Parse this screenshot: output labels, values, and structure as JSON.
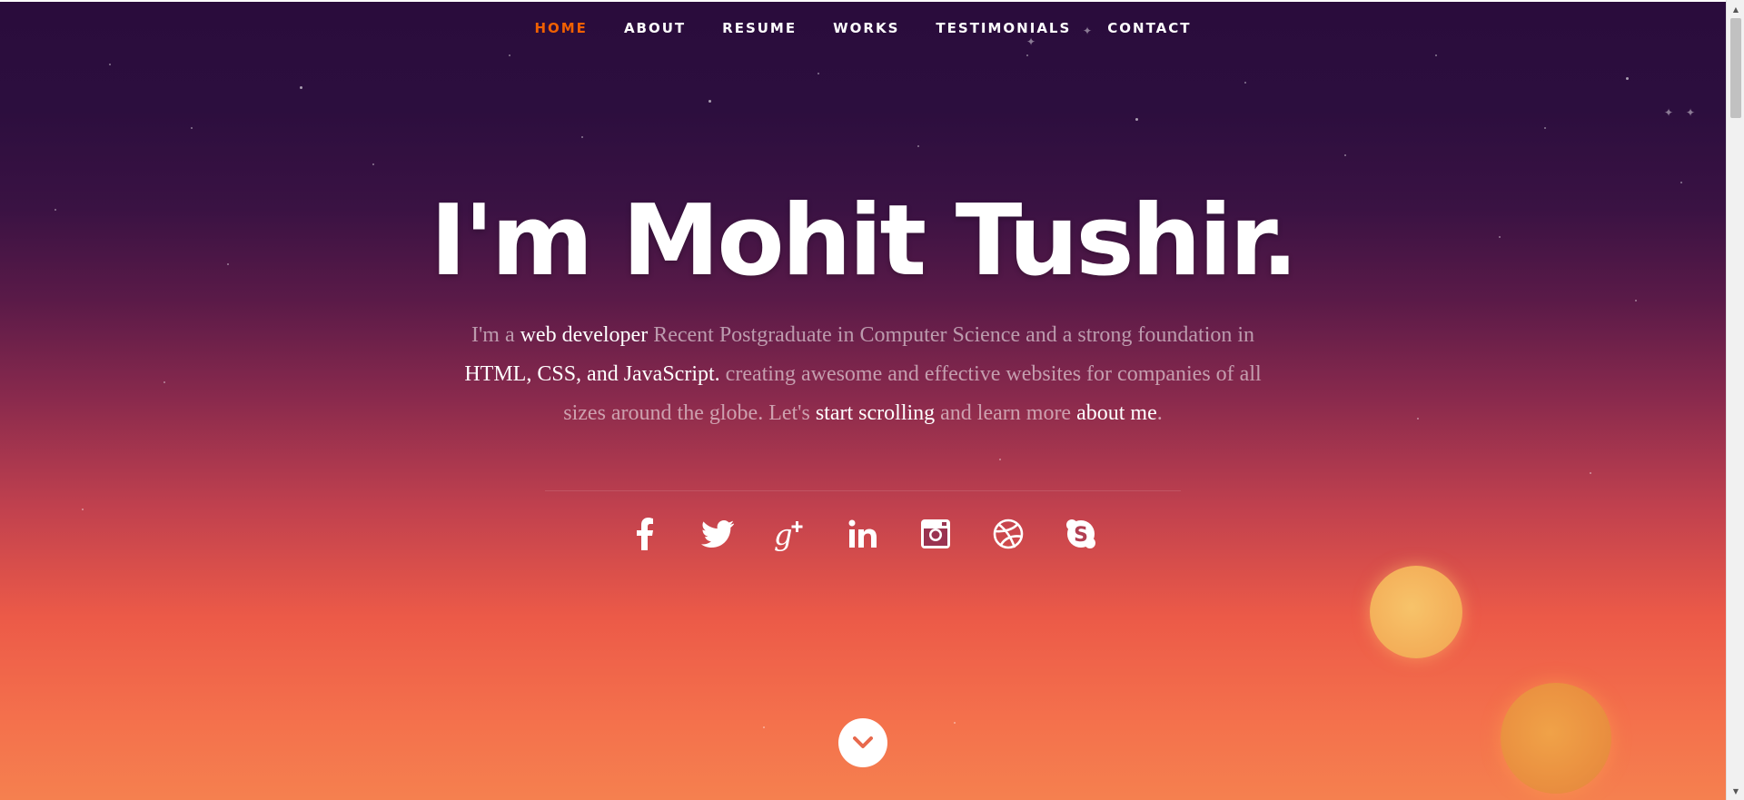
{
  "nav": {
    "items": [
      {
        "label": "HOME",
        "active": true
      },
      {
        "label": "ABOUT",
        "active": false
      },
      {
        "label": "RESUME",
        "active": false
      },
      {
        "label": "WORKS",
        "active": false
      },
      {
        "label": "TESTIMONIALS",
        "active": false
      },
      {
        "label": "CONTACT",
        "active": false
      }
    ]
  },
  "hero": {
    "title": "I'm Mohit Tushir.",
    "intro": {
      "p1": "I'm a ",
      "h1": "web developer",
      "p2": " Recent Postgraduate in Computer Science and a strong foundation in ",
      "h2": "HTML, CSS, and JavaScript.",
      "p3": " creating awesome and effective websites for companies of all sizes around the globe. Let's ",
      "h3": "start scrolling",
      "p4": " and learn more ",
      "h4": "about me",
      "p5": "."
    }
  },
  "social": {
    "icons": [
      "facebook-icon",
      "twitter-icon",
      "google-plus-icon",
      "linkedin-icon",
      "instagram-icon",
      "dribbble-icon",
      "skype-icon"
    ]
  },
  "colors": {
    "accent": "#f06000",
    "text": "#ffffff",
    "muted_text": "rgba(255,255,255,0.55)"
  }
}
